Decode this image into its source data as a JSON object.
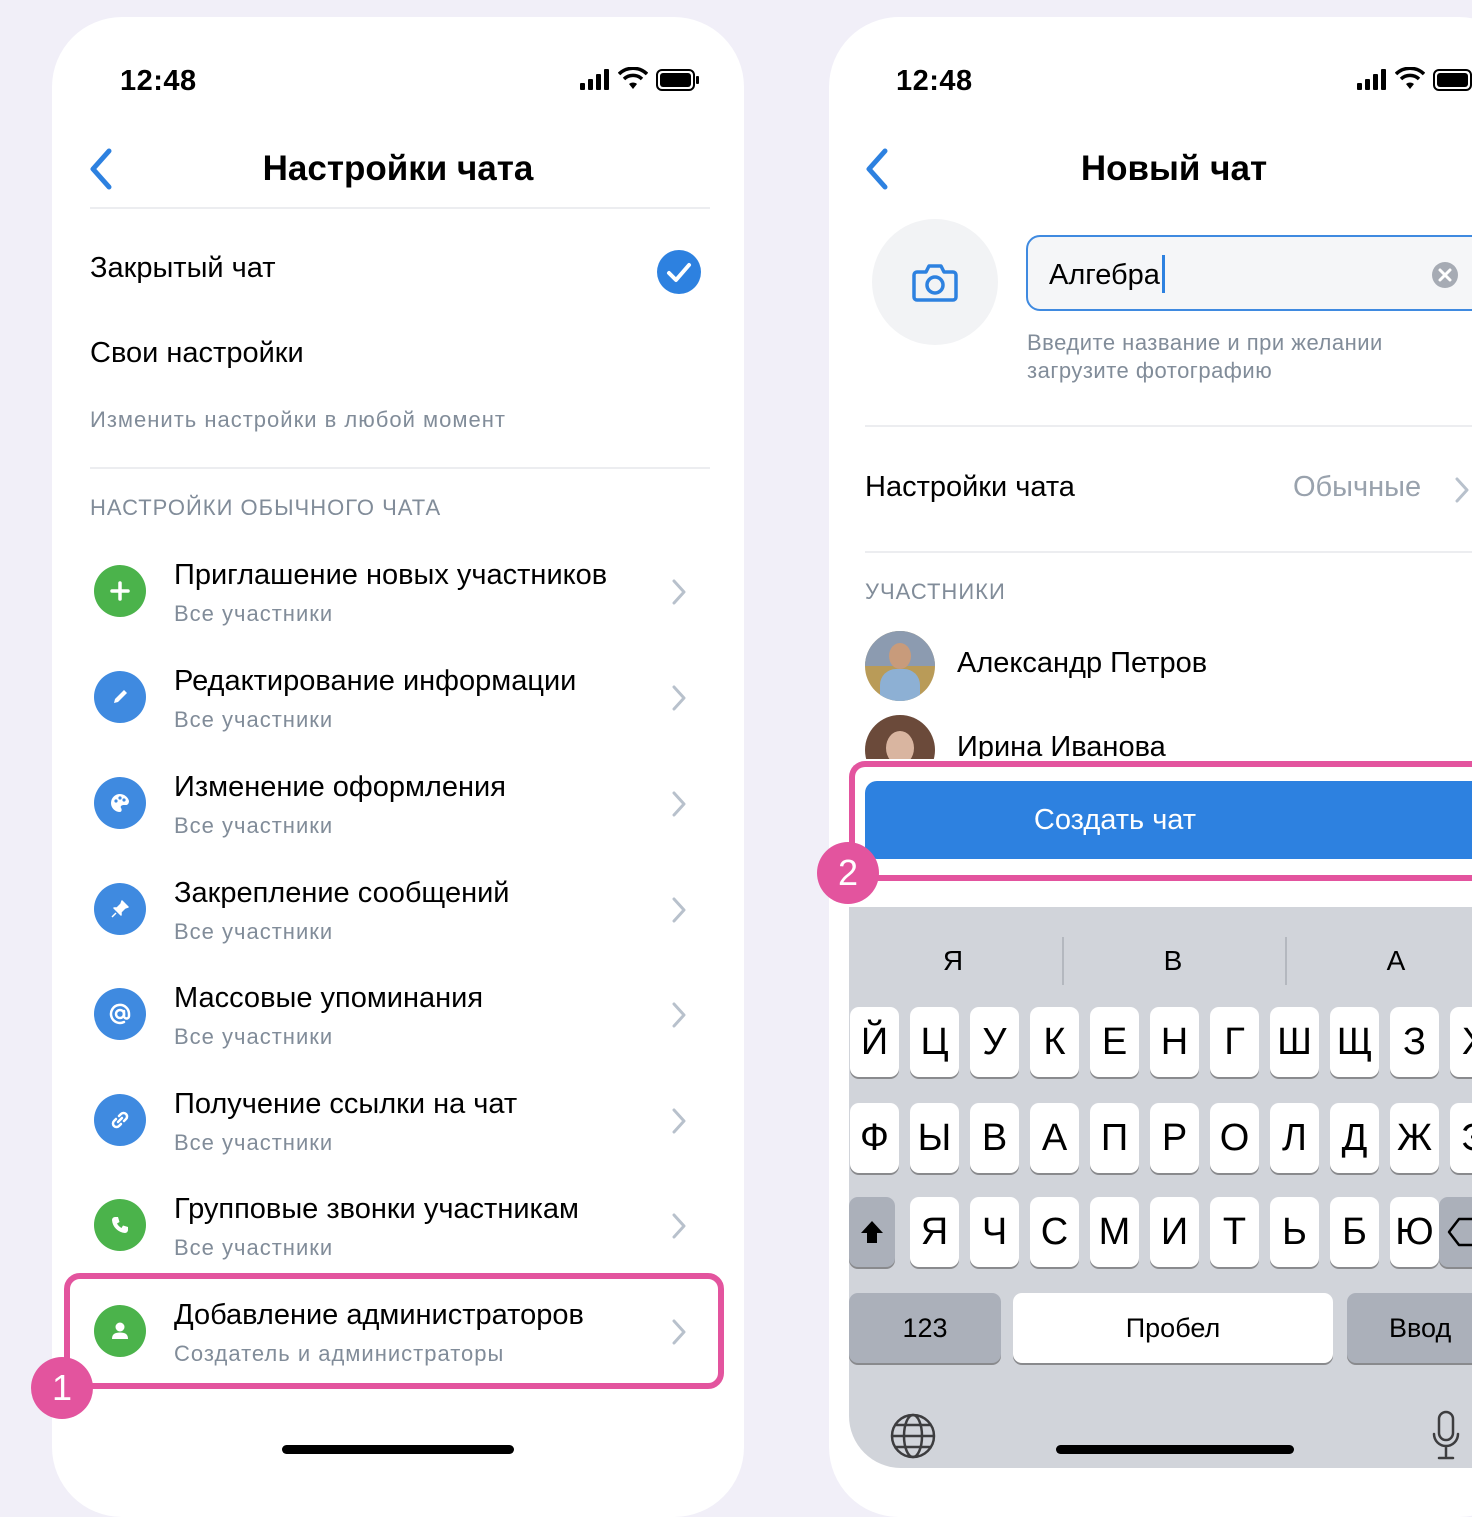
{
  "left_phone": {
    "status_time": "12:48",
    "title": "Настройки чата",
    "closed_chat_label": "Закрытый чат",
    "custom_settings_label": "Свои настройки",
    "custom_settings_hint": "Изменить настройки в любой момент",
    "section_header": "НАСТРОЙКИ ОБЫЧНОГО ЧАТА",
    "rows": [
      {
        "title": "Приглашение новых участников",
        "subtitle": "Все участники",
        "icon": "plus-icon",
        "color": "#4bb34b"
      },
      {
        "title": "Редактирование информации",
        "subtitle": "Все участники",
        "icon": "pencil-icon",
        "color": "#3f8ae0"
      },
      {
        "title": "Изменение оформления",
        "subtitle": "Все участники",
        "icon": "palette-icon",
        "color": "#3f8ae0"
      },
      {
        "title": "Закрепление сообщений",
        "subtitle": "Все участники",
        "icon": "pin-icon",
        "color": "#3f8ae0"
      },
      {
        "title": "Массовые упоминания",
        "subtitle": "Все участники",
        "icon": "at-icon",
        "color": "#3f8ae0"
      },
      {
        "title": "Получение ссылки на чат",
        "subtitle": "Все участники",
        "icon": "link-icon",
        "color": "#3f8ae0"
      },
      {
        "title": "Групповые звонки участникам",
        "subtitle": "Все участники",
        "icon": "phone-icon",
        "color": "#4bb34b"
      },
      {
        "title": "Добавление администраторов",
        "subtitle": "Создатель и администраторы",
        "icon": "user-icon",
        "color": "#4bb34b"
      }
    ],
    "badge": "1"
  },
  "right_phone": {
    "status_time": "12:48",
    "title": "Новый чат",
    "name_input_value": "Алгебра",
    "name_hint": "Введите название и при желании загрузите фотографию",
    "chat_settings_label": "Настройки чата",
    "chat_settings_value": "Обычные",
    "members_header": "УЧАСТНИКИ",
    "members": [
      "Александр Петров",
      "Ирина Иванова"
    ],
    "create_button": "Создать чат",
    "badge": "2",
    "keyboard": {
      "suggestions": [
        "Я",
        "В",
        "А"
      ],
      "row1": [
        "Й",
        "Ц",
        "У",
        "К",
        "Е",
        "Н",
        "Г",
        "Ш",
        "Щ",
        "З",
        "Х"
      ],
      "row2": [
        "Ф",
        "Ы",
        "В",
        "А",
        "П",
        "Р",
        "О",
        "Л",
        "Д",
        "Ж",
        "Э"
      ],
      "row3": [
        "Я",
        "Ч",
        "С",
        "М",
        "И",
        "Т",
        "Ь",
        "Б",
        "Ю"
      ],
      "numbers_key": "123",
      "space_key": "Пробел",
      "enter_key": "Ввод"
    }
  },
  "colors": {
    "accent": "#2d81e0",
    "highlight": "#e3549e",
    "background": "#f1eff8"
  }
}
